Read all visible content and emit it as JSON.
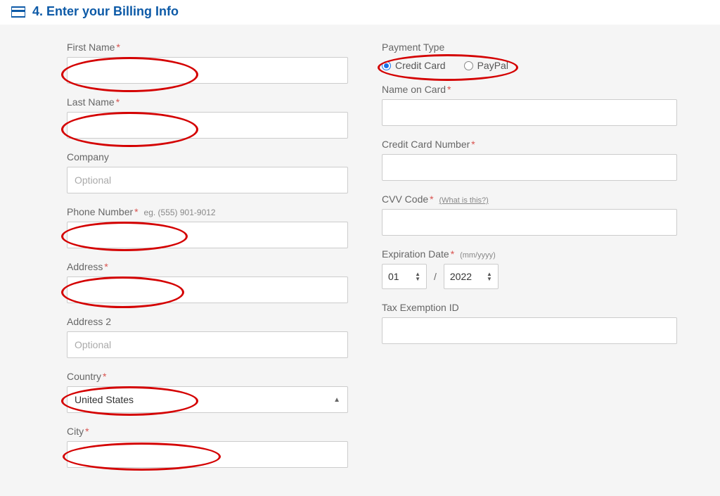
{
  "header": {
    "title": "4. Enter your Billing Info"
  },
  "left": {
    "first_name": {
      "label": "First Name",
      "value": ""
    },
    "last_name": {
      "label": "Last Name",
      "value": ""
    },
    "company": {
      "label": "Company",
      "placeholder": "Optional",
      "value": ""
    },
    "phone": {
      "label": "Phone Number",
      "hint": "eg. (555) 901-9012",
      "value": ""
    },
    "address": {
      "label": "Address",
      "value": ""
    },
    "address2": {
      "label": "Address 2",
      "placeholder": "Optional",
      "value": ""
    },
    "country": {
      "label": "Country",
      "value": "United States"
    },
    "city": {
      "label": "City",
      "value": ""
    }
  },
  "right": {
    "payment_type": {
      "label": "Payment Type",
      "options": {
        "credit": "Credit Card",
        "paypal": "PayPal"
      },
      "selected": "credit"
    },
    "name_on_card": {
      "label": "Name on Card",
      "value": ""
    },
    "cc_number": {
      "label": "Credit Card Number",
      "value": ""
    },
    "cvv": {
      "label": "CVV Code",
      "help": "(What is this?)",
      "value": ""
    },
    "expiration": {
      "label": "Expiration Date",
      "hint": "(mm/yyyy)",
      "month": "01",
      "sep": "/",
      "year": "2022"
    },
    "tax_id": {
      "label": "Tax Exemption ID",
      "value": ""
    }
  }
}
